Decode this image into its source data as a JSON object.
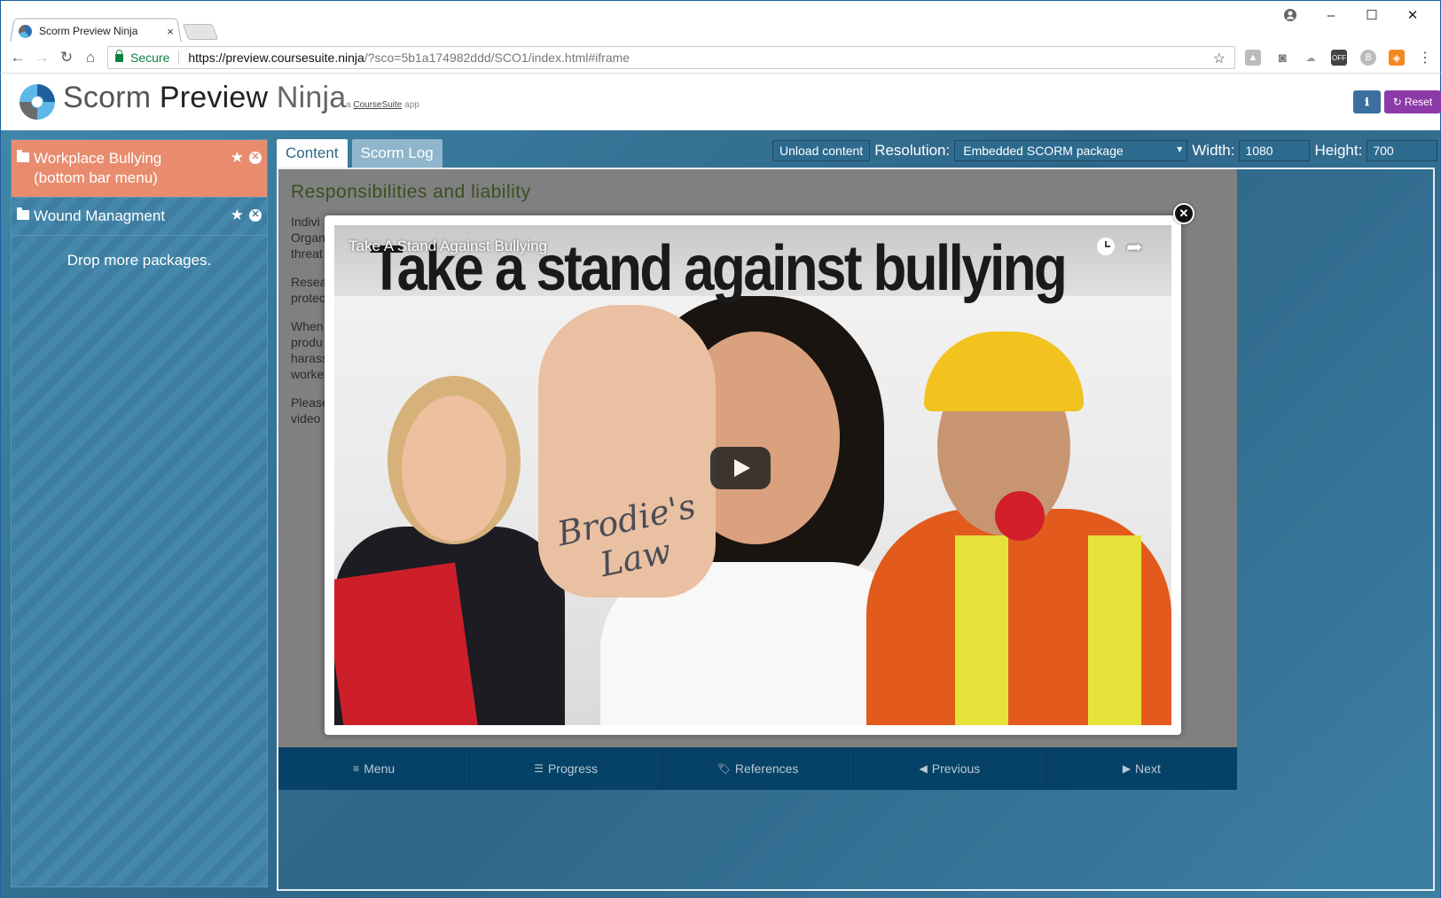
{
  "browser": {
    "tab_title": "Scorm Preview Ninja",
    "tab_close": "×",
    "secure_label": "Secure",
    "url_host": "https://preview.coursesuite.ninja",
    "url_rest": "/?sco=5b1a174982ddd/SCO1/index.html#iframe",
    "window_controls": [
      "–",
      "☐",
      "✕"
    ]
  },
  "header": {
    "brand_1": "Scorm",
    "brand_2": "Preview",
    "brand_3": "Ninja",
    "sub_prefix": "a",
    "sub_link": "CourseSuite",
    "sub_suffix": "app",
    "info_label": "ℹ",
    "reset_label": "Reset"
  },
  "sidebar": {
    "packages": [
      {
        "label": "Workplace Bullying (bottom bar menu)",
        "active": true
      },
      {
        "label": "Wound Managment",
        "active": false
      }
    ],
    "drop_text": "Drop more packages."
  },
  "tabs": {
    "content": "Content",
    "scorm_log": "Scorm Log"
  },
  "controls": {
    "unload": "Unload content",
    "resolution_label": "Resolution:",
    "resolution_value": "Embedded SCORM package",
    "width_label": "Width:",
    "width_value": "1080",
    "height_label": "Height:",
    "height_value": "700"
  },
  "course": {
    "heading": "Responsibilities and liability",
    "paragraphs": [
      [
        "Indivi",
        "Organ",
        "threat"
      ],
      [
        "Resea",
        "protec"
      ],
      [
        "When",
        "produ",
        "harass",
        "worke"
      ],
      [
        "Please",
        "video"
      ]
    ]
  },
  "video": {
    "title": "Take A Stand Against Bullying",
    "headline": "Take a stand against bullying",
    "hand_text_1": "Brodie's",
    "hand_text_2": "Law"
  },
  "bottom_bar": [
    {
      "label": "Menu",
      "icon": "≡"
    },
    {
      "label": "Progress",
      "icon": "☰"
    },
    {
      "label": "References",
      "icon": "🏷"
    },
    {
      "label": "Previous",
      "icon": "◀"
    },
    {
      "label": "Next",
      "icon": "▶"
    }
  ],
  "colors": {
    "active_package": "#e98c6e",
    "bottom_bar": "#064267",
    "reset_button": "#8c3aa8",
    "main_bg": "#2e6688"
  }
}
